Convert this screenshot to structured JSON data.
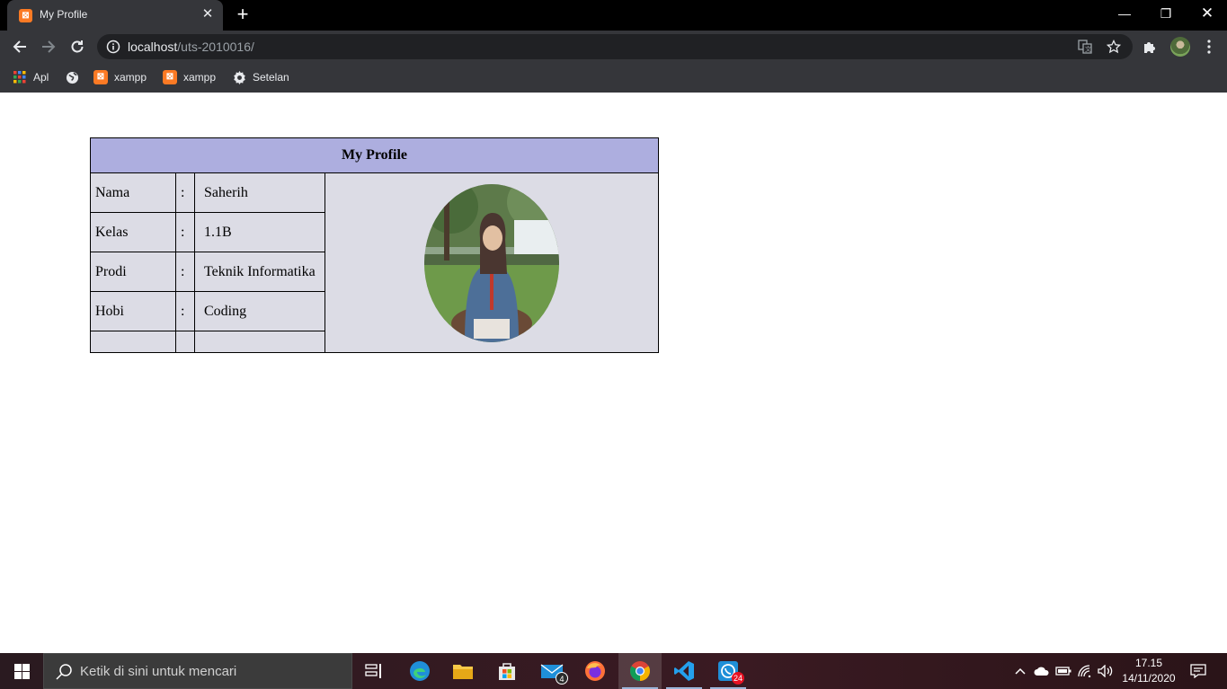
{
  "browser": {
    "tab_title": "My Profile",
    "tab_favicon": "xampp-icon",
    "url_host": "localhost",
    "url_path": "/uts-2010016/",
    "bookmarks": [
      {
        "label": "Apl",
        "icon": "apps-grid-icon"
      },
      {
        "label": "",
        "icon": "globe-icon"
      },
      {
        "label": "xampp",
        "icon": "xampp-icon"
      },
      {
        "label": "xampp",
        "icon": "xampp-icon"
      },
      {
        "label": "Setelan",
        "icon": "gear-icon"
      }
    ]
  },
  "profile": {
    "title": "My Profile",
    "rows": [
      {
        "label": "Nama",
        "sep": ":",
        "value": "Saherih"
      },
      {
        "label": "Kelas",
        "sep": ":",
        "value": "1.1B"
      },
      {
        "label": "Prodi",
        "sep": ":",
        "value": "Teknik Informatika"
      },
      {
        "label": "Hobi",
        "sep": ":",
        "value": "Coding"
      },
      {
        "label": "",
        "sep": "",
        "value": ""
      }
    ],
    "header_color": "#adaedf",
    "cell_color": "#dcdce5"
  },
  "taskbar": {
    "search_placeholder": "Ketik di sini untuk mencari",
    "apps": [
      {
        "name": "task-view"
      },
      {
        "name": "edge"
      },
      {
        "name": "file-explorer"
      },
      {
        "name": "microsoft-store"
      },
      {
        "name": "mail",
        "badge": "4"
      },
      {
        "name": "firefox"
      },
      {
        "name": "chrome",
        "active": true
      },
      {
        "name": "vscode"
      },
      {
        "name": "whatsapp",
        "badge": "24"
      }
    ],
    "time": "17.15",
    "date": "14/11/2020"
  }
}
